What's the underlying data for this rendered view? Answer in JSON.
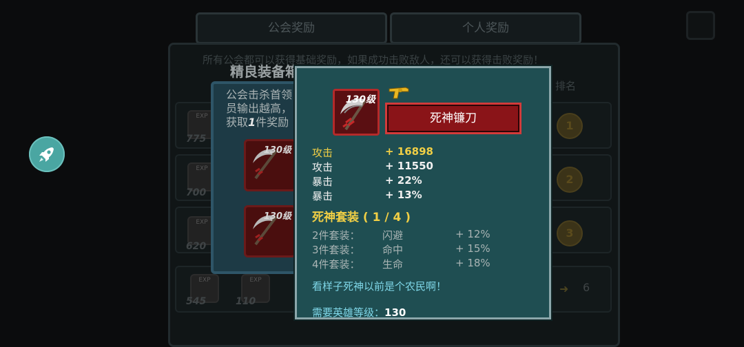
{
  "tabs": {
    "guild_rewards": "公会奖励",
    "personal_rewards": "个人奖励"
  },
  "notice": "所有公会都可以获得基础奖励，如果成功击败敌人，还可以获得击败奖励！",
  "rank_header": "排名",
  "box_title": "精良装备箱",
  "box_desc_lines": [
    "公会击杀首领",
    "员输出越高，",
    "获取",
    "1",
    "件奖励"
  ],
  "bg_rows": [
    {
      "exp": "775",
      "medal": "1"
    },
    {
      "exp": "700",
      "medal": "2"
    },
    {
      "exp": "620",
      "medal": "3"
    }
  ],
  "bottom_row": {
    "exp_a": "545",
    "exp_b": "110",
    "count": "6"
  },
  "item": {
    "level_tag": "130级",
    "name": "死神镰刀",
    "stats": [
      {
        "label": "攻击",
        "value": "+ 16898",
        "color": "#f1cf45"
      },
      {
        "label": "攻击",
        "value": "+ 11550",
        "color": "#f0f0f0"
      },
      {
        "label": "暴击",
        "value": "+ 22%",
        "color": "#f0f0f0"
      },
      {
        "label": "暴击",
        "value": "+ 13%",
        "color": "#f0f0f0"
      }
    ],
    "set_title": "死神套装 ( 1 / 4 )",
    "set_bonuses": [
      {
        "pieces": "2件套装：",
        "attr": "闪避",
        "value": "+ 12%"
      },
      {
        "pieces": "3件套装：",
        "attr": "命中",
        "value": "+ 15%"
      },
      {
        "pieces": "4件套装：",
        "attr": "生命",
        "value": "+ 18%"
      }
    ],
    "flavor": "看样子死神以前是个农民啊！",
    "requirement_label": "需要英雄等级：",
    "requirement_value": "130"
  },
  "colors": {
    "accent_gold": "#f1cf45",
    "flavor_cyan": "#7fd7e8",
    "name_red": "#8a1418",
    "panel_teal": "#1f4e52"
  },
  "icons": {
    "rocket": "rocket-icon",
    "weapon": "scythe-icon",
    "set_badge": "revolver-icon"
  }
}
